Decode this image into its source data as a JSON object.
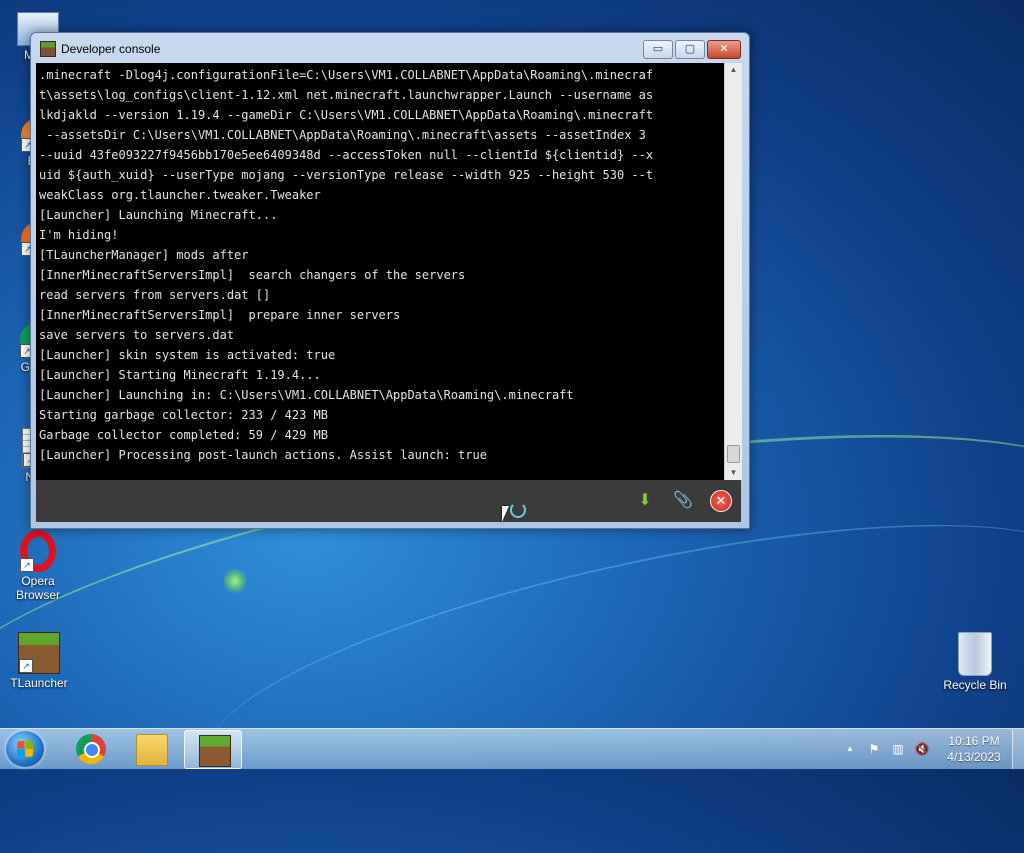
{
  "desktop": {
    "icons": [
      {
        "label": "My C"
      },
      {
        "label": "Eve"
      },
      {
        "label": "Fi"
      },
      {
        "label": "Go Ch"
      },
      {
        "label": "Note"
      },
      {
        "label": "Opera Browser"
      },
      {
        "label": "TLauncher"
      },
      {
        "label": "Recycle Bin"
      }
    ]
  },
  "window": {
    "title": "Developer console",
    "minimize": "▭",
    "maximize": "▢",
    "close": "✕"
  },
  "console": {
    "lines": [
      ".minecraft -Dlog4j.configurationFile=C:\\Users\\VM1.COLLABNET\\AppData\\Roaming\\.minecraf",
      "t\\assets\\log_configs\\client-1.12.xml net.minecraft.launchwrapper.Launch --username as",
      "lkdjakld --version 1.19.4 --gameDir C:\\Users\\VM1.COLLABNET\\AppData\\Roaming\\.minecraft",
      " --assetsDir C:\\Users\\VM1.COLLABNET\\AppData\\Roaming\\.minecraft\\assets --assetIndex 3",
      "--uuid 43fe093227f9456bb170e5ee6409348d --accessToken null --clientId ${clientid} --x",
      "uid ${auth_xuid} --userType mojang --versionType release --width 925 --height 530 --t",
      "weakClass org.tlauncher.tweaker.Tweaker",
      "[Launcher] Launching Minecraft...",
      "I'm hiding!",
      "[TLauncherManager] mods after",
      "[InnerMinecraftServersImpl]  search changers of the servers",
      "read servers from servers.dat []",
      "[InnerMinecraftServersImpl]  prepare inner servers",
      "save servers to servers.dat",
      "[Launcher] skin system is activated: true",
      "[Launcher] Starting Minecraft 1.19.4...",
      "[Launcher] Launching in: C:\\Users\\VM1.COLLABNET\\AppData\\Roaming\\.minecraft",
      "Starting garbage collector: 233 / 423 MB",
      "Garbage collector completed: 59 / 429 MB",
      "[Launcher] Processing post-launch actions. Assist launch: true"
    ]
  },
  "toolbar": {
    "download_icon": "⬇",
    "attach_icon": "📎",
    "close_icon": "✕"
  },
  "taskbar": {
    "items": [
      "start-button",
      "chrome",
      "explorer",
      "tlauncher"
    ],
    "tray_arrow": "▲",
    "clock_time": "10:16 PM",
    "clock_date": "4/13/2023"
  },
  "colors": {
    "console_bg": "#000000",
    "console_text": "#e2e2e2",
    "bottom_bar": "#3b3b3b"
  }
}
